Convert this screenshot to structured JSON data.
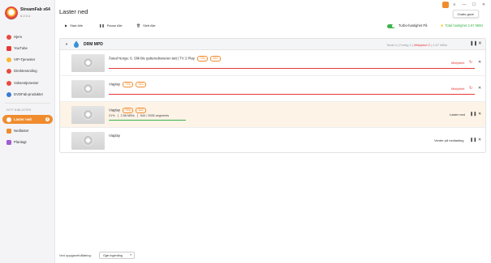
{
  "app": {
    "name": "StreamFab x64",
    "version": "6.2.0.4"
  },
  "sidebar": {
    "items": [
      {
        "label": "Hjem",
        "icon": "home-icon",
        "color": "#e84a3c"
      },
      {
        "label": "YouTube",
        "icon": "youtube-icon",
        "color": "#e53935"
      },
      {
        "label": "VIP-Tjenester",
        "icon": "vip-icon",
        "color": "#f7b731"
      },
      {
        "label": "Direktesending",
        "icon": "live-icon",
        "color": "#e84a3c"
      },
      {
        "label": "Voksentjenester",
        "icon": "adult-icon",
        "color": "#e84a3c"
      },
      {
        "label": "DVDFab-produkter",
        "icon": "dvdfab-icon",
        "color": "#3a7bd5"
      }
    ],
    "library_label": "DITT BIBLIOTEK",
    "library": [
      {
        "label": "Laster ned",
        "icon": "download-icon",
        "active": true,
        "badge": "4"
      },
      {
        "label": "Nedlastet",
        "icon": "downloaded-icon",
        "color": "#f08c2e"
      },
      {
        "label": "Planlagt",
        "icon": "scheduled-icon",
        "color": "#a05cd5"
      }
    ]
  },
  "header": {
    "title": "Laster ned",
    "tooltip": "Gratis gave",
    "window_controls": [
      "≡",
      "—",
      "☐",
      "✕"
    ]
  },
  "toolbar": {
    "start_all": "Start Alle",
    "pause_all": "Pause Alle",
    "remove_all": "Slett Alle",
    "turbo_label": "Turbo-hastighet På",
    "total_speed": "Total hastighet 2.67 MB/s"
  },
  "group": {
    "title": "DRM MPD",
    "total": "Totalt  4",
    "done": "Ferdig  0",
    "failed": "Mislykket  2",
    "speed": "2.67 MB/s"
  },
  "rows": [
    {
      "title": "Åsted Norge: 6. Slik ble gutteredraneren tatt | TV 2 Play",
      "tags": [
        "720p",
        "AAC"
      ],
      "status": "Mislykket",
      "state": "failed"
    },
    {
      "title": "Viaplay",
      "tags": [
        "720p",
        "AAC"
      ],
      "status": "Mislykket",
      "state": "failed"
    },
    {
      "title": "Viaplay",
      "tags": [
        "720p",
        "AAC"
      ],
      "status": "Laster ned",
      "state": "downloading",
      "percent": "21%",
      "size": "2.56 MB/s",
      "segments": "544 / 2535 segments",
      "progress": 0.21
    },
    {
      "title": "Viaplay",
      "tags": [],
      "status": "Venter på nedlasting",
      "state": "waiting"
    }
  ],
  "footer": {
    "label": "Ved oppgavefullføring:",
    "select_value": "Gjør ingenting"
  }
}
